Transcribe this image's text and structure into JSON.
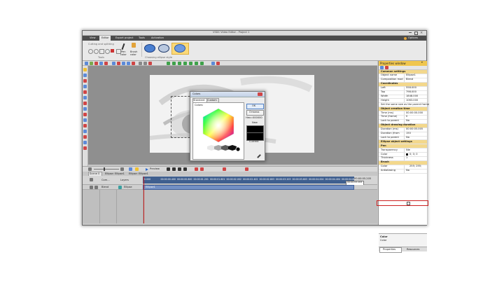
{
  "window": {
    "title": "VSDC Video Editor - Project 1",
    "options": "Options"
  },
  "menu": [
    "View",
    "Editor",
    "Export project",
    "Tools",
    "Activation"
  ],
  "ribbon": {
    "cutting": "Cutting and splitting",
    "pen_label": "Pen",
    "pen_sub": "color",
    "brush_label": "Brush",
    "brush_sub": "color",
    "group_tools": "Tools",
    "group_styles": "Choosing ellipse style"
  },
  "colors_dialog": {
    "title": "Colors",
    "tabs": [
      "Standard",
      "Custom"
    ],
    "colors_label": "Colors:",
    "ok": "OK",
    "cancel": "Отмена",
    "hex": "Hex=000000",
    "new_label": "New",
    "current_label": "Current"
  },
  "timeline": {
    "preview_label": "Preview",
    "tabs": [
      "Scene 0",
      "Ellipse: Ellipse1",
      "Ellipse: Ellipse1"
    ],
    "header": [
      "Com...",
      "Layers"
    ],
    "rows": [
      {
        "blend": "Blend",
        "layer": "Ellipse"
      }
    ],
    "clip_label": "Ellipse1",
    "ruler": [
      "0.000",
      "00:00:00.400",
      "00:00:00.800",
      "00:00:01.201",
      "00:00:01.601",
      "00:00:02.002",
      "00:00:02.402",
      "00:00:02.803",
      "00:00:03.203",
      "00:00:03.603",
      "00:00:04.004",
      "00:00:04.404",
      "00:00:04.805"
    ],
    "ruler_end": "00:00:05.205",
    "position": "00:00:05.005"
  },
  "properties": {
    "title": "Properties window",
    "rows": [
      {
        "section": "Common settings"
      },
      {
        "label": "Object name",
        "value": "Ellipse1"
      },
      {
        "label": "Composition mod",
        "value": "Blend"
      },
      {
        "section": "Coordinates"
      },
      {
        "label": "Left",
        "value": "558.000"
      },
      {
        "label": "Top",
        "value": "798.000"
      },
      {
        "label": "Width",
        "value": "1848.000"
      },
      {
        "label": "Height",
        "value": "1063.000"
      },
      {
        "label": "Set the same size as the parent frame",
        "value": ""
      },
      {
        "section": "Object creation time"
      },
      {
        "label": "Time (ms)",
        "value": "00:00:00.000"
      },
      {
        "label": "Time (frame)",
        "value": "0"
      },
      {
        "label": "Lock to parent",
        "value": "No"
      },
      {
        "section": "Object drawing duration"
      },
      {
        "label": "Duration (ms)",
        "value": "00:00:05.005"
      },
      {
        "label": "Duration (fram",
        "value": "150"
      },
      {
        "label": "Lock to parent",
        "value": "No"
      },
      {
        "section": "Ellipse object settings"
      },
      {
        "section": "Pen"
      },
      {
        "label": "Transparency",
        "value": "Nie"
      },
      {
        "label": "Color",
        "value": "0; 0; 0"
      },
      {
        "label": "Thickness",
        "value": "1"
      },
      {
        "section": "Brush"
      },
      {
        "label": "Color",
        "value": "255; 255;"
      },
      {
        "label": "Antialiasing",
        "value": "No"
      }
    ],
    "help_title": "Color",
    "help_text": "Color",
    "bottom_tabs": [
      "Properties",
      "Resources"
    ]
  },
  "accent_colors": {
    "highlight": "#cc2020",
    "section": "#f3d88c",
    "selection": "#3a7bd5",
    "ruler": "#3f5f8f"
  }
}
